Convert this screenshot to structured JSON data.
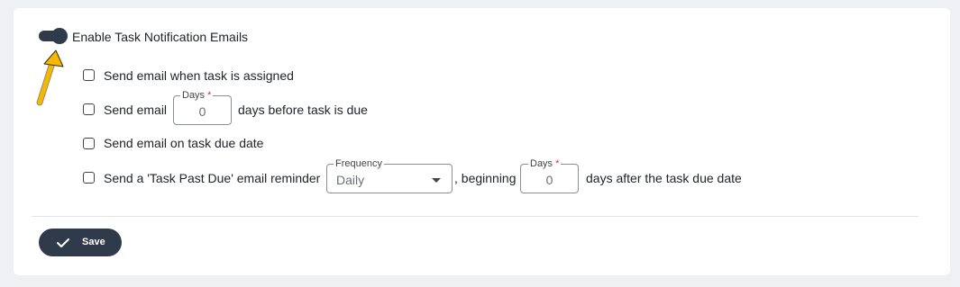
{
  "notifications": {
    "enable_label": "Enable Task Notification Emails",
    "enabled": true
  },
  "options": {
    "assigned_label": "Send email when task is assigned",
    "before_due_prefix": "Send email",
    "before_due_suffix": "days before task is due",
    "due_date_label": "Send email on task due date",
    "past_due_prefix": "Send a 'Task Past Due' email reminder",
    "past_due_middle": ", beginning",
    "past_due_suffix": "days after the task due date"
  },
  "fields": {
    "days_before": {
      "legend": "Days",
      "required": "*",
      "value": "0"
    },
    "frequency": {
      "legend": "Frequency",
      "value": "Daily"
    },
    "days_after": {
      "legend": "Days",
      "required": "*",
      "value": "0"
    }
  },
  "actions": {
    "save_label": "Save"
  },
  "colors": {
    "primary": "#2f3a4a",
    "arrow": "#f5b800",
    "required": "#d32f2f"
  }
}
